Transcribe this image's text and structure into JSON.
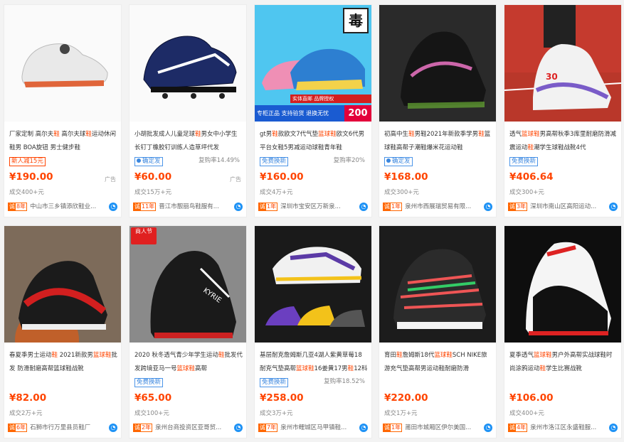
{
  "products": [
    {
      "title_pre": "厂家定制 高尔夫",
      "title_h1": "鞋",
      "title_mid": " 高尔夫球",
      "title_h2": "鞋",
      "title_post": "运动休闲鞋男 BOA旋钮 男士健步鞋",
      "tag": "新人减15元",
      "tag_style": "red",
      "rate": "",
      "price": "¥190.00",
      "ad": "广告",
      "sales": "成交400+元",
      "years": "8年",
      "shop": "中山市三乡镇添欣鞋业...",
      "image": "white-golf-shoe-photo",
      "bg": "#fafafa"
    },
    {
      "title_pre": "小胡批发成人儿童足球",
      "title_h1": "鞋",
      "title_mid": "男女中小学生长钉",
      "title_h2": "",
      "title_post": "丁橡胶钉训练人造草坪代发",
      "tag": "确定发",
      "tag_style": "blue-dot",
      "rate": "复购率14.49%",
      "price": "¥60.00",
      "ad": "广告",
      "sales": "成交15万+元",
      "years": "11年",
      "shop": "晋江市靓丽鸟鞋服有...",
      "image": "navy-football-cleat-photo",
      "bg": "#fafafa"
    },
    {
      "title_pre": "gt男",
      "title_h1": "鞋",
      "title_mid": "款欧文7代气垫",
      "title_h2": "篮球鞋",
      "title_post": "欧文6代男平台女鞋5男减运动球鞋青年鞋",
      "tag": "免费换新",
      "tag_style": "blue",
      "rate": "复购率20%",
      "price": "¥160.00",
      "ad": "",
      "sales": "成交4万+元",
      "years": "1年",
      "shop": "深圳市宝安区万新泉...",
      "image": "blue-pink-basketball-shoes-photo",
      "bg": "#4fc6f0",
      "logo_text": "毒",
      "promo": "专柜正品 支持验货 退换无忧",
      "promo_top": "实体直邮 品牌授权",
      "badge": "200"
    },
    {
      "title_pre": "初高中生",
      "title_h1": "鞋",
      "title_mid": "男鞋2021年新款季学男",
      "title_h2": "鞋",
      "title_post": "篮球鞋高帮子潮鞋爆米花运动鞋",
      "tag": "确定发",
      "tag_style": "blue-dot",
      "rate": "",
      "price": "¥168.00",
      "ad": "",
      "sales": "成交300+元",
      "years": "1年",
      "shop": "泉州市西展瑞贸易有限...",
      "image": "black-iridescent-basketball-shoe-photo",
      "bg": "#2a2a2a"
    },
    {
      "title_pre": "透气",
      "title_h1": "篮球鞋",
      "title_mid": "男高帮秋季3库里耐磨防滑减震运动",
      "title_h2": "鞋",
      "title_post": "潮学生球鞋战靴4代",
      "tag": "免费换新",
      "tag_style": "blue",
      "rate": "",
      "price": "¥406.64",
      "ad": "",
      "sales": "成交300+元",
      "years": "3年",
      "shop": "深圳市南山区高阳运动...",
      "image": "curry-high-top-shoe-on-track-photo",
      "bg": "#c53a2e"
    },
    {
      "title_pre": "春夏季男士运动",
      "title_h1": "鞋",
      "title_mid": " 2021新款男",
      "title_h2": "篮球鞋",
      "title_post": "批发 防滑耐磨高帮篮球鞋战靴",
      "tag": "",
      "tag_style": "",
      "rate": "",
      "price": "¥82.00",
      "ad": "",
      "sales": "成交2万+元",
      "years": "6年",
      "shop": "石狮市行万里县员鞋厂",
      "image": "red-black-jordan-shoe-lacing-photo",
      "bg": "#6a5a4a"
    },
    {
      "title_pre": "2020 秋冬透气青少年学生运动",
      "title_h1": "鞋",
      "title_mid": "批发代发跨境亚马一号",
      "title_h2": "篮球鞋",
      "title_post": "高帮",
      "tag": "免费换新",
      "tag_style": "blue",
      "rate": "",
      "price": "¥65.00",
      "ad": "",
      "sales": "成交100+元",
      "years": "2年",
      "shop": "泉州台商投资区亚哥贸...",
      "image": "kyrie-black-red-shoe-photo",
      "bg": "#9a9a9a",
      "holiday": "商人节"
    },
    {
      "title_pre": "基层耐克詹姆斯几亚4湖人紫黄草莓18耐克气垫高帮",
      "title_h1": "篮球鞋",
      "title_mid": "16姜黄17男",
      "title_h2": "鞋",
      "title_post": "12科比11",
      "tag": "免费换新",
      "tag_style": "blue",
      "rate": "复购率18.52%",
      "price": "¥258.00",
      "ad": "",
      "sales": "成交3万+元",
      "years": "7年",
      "shop": "泉州市鲤城区马甲镇鞋...",
      "image": "purple-lakers-shoes-group-photo",
      "bg": "#1a1a1a"
    },
    {
      "title_pre": "育田",
      "title_h1": "鞋",
      "title_mid": "詹姆斯18代",
      "title_h2": "篮球鞋",
      "title_post": "SCH NIKE旅游充气垫高帮男运动鞋耐磨防滑",
      "tag": "",
      "tag_style": "",
      "rate": "",
      "price": "¥220.00",
      "ad": "",
      "sales": "成交1万+元",
      "years": "1年",
      "shop": "莆田市城厢区伊尔美国...",
      "image": "lebron-multicolor-shoe-photo",
      "bg": "#1c1c1c"
    },
    {
      "title_pre": "夏季透气",
      "title_h1": "篮球鞋",
      "title_mid": "男户外高帮实战球鞋时尚涂鸦运动",
      "title_h2": "鞋",
      "title_post": "学生比赛战靴",
      "tag": "",
      "tag_style": "",
      "rate": "",
      "price": "¥106.00",
      "ad": "",
      "sales": "成交400+元",
      "years": "4年",
      "shop": "泉州市洛江区永盛鞋服...",
      "image": "black-white-red-high-top-shoe-photo",
      "bg": "#0e0e0e"
    }
  ]
}
